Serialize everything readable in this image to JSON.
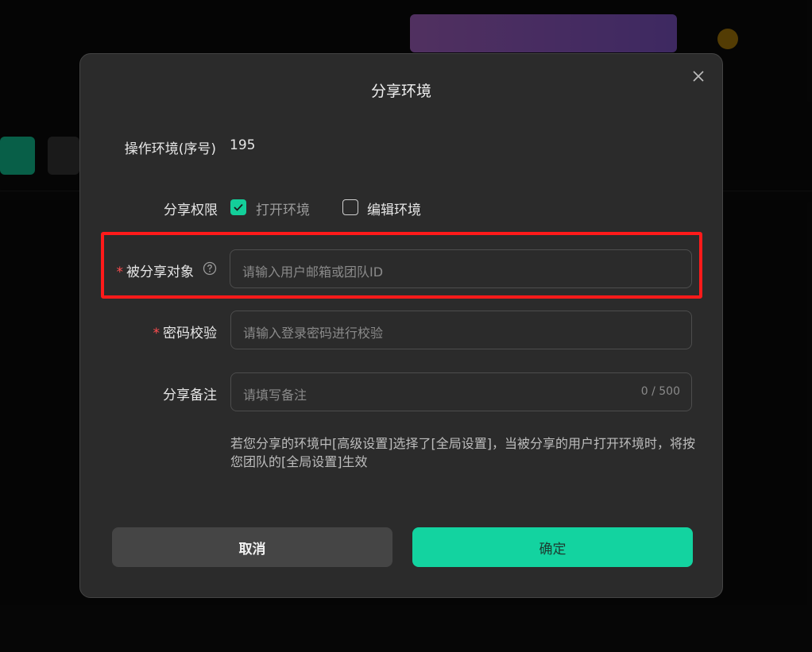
{
  "modal": {
    "title": "分享环境",
    "close_icon": "close-icon",
    "env_label": "操作环境(序号)",
    "env_value": "195",
    "permission_label": "分享权限",
    "permissions": [
      {
        "label": "打开环境",
        "checked": true
      },
      {
        "label": "编辑环境",
        "checked": false
      }
    ],
    "target": {
      "required_mark": "*",
      "label": "被分享对象",
      "help_icon": "question-circle-icon",
      "placeholder": "请输入用户邮箱或团队ID"
    },
    "password": {
      "required_mark": "*",
      "label": "密码校验",
      "placeholder": "请输入登录密码进行校验"
    },
    "remark": {
      "label": "分享备注",
      "placeholder": "请填写备注",
      "counter": "0 / 500"
    },
    "note": "若您分享的环境中[高级设置]选择了[全局设置]，当被分享的用户打开环境时，将按您团队的[全局设置]生效",
    "cancel_label": "取消",
    "confirm_label": "确定"
  },
  "colors": {
    "accent": "#13d3a0",
    "highlight": "#ff1a1a",
    "required": "#ff4d4f",
    "modal_bg": "#2b2b2b"
  }
}
